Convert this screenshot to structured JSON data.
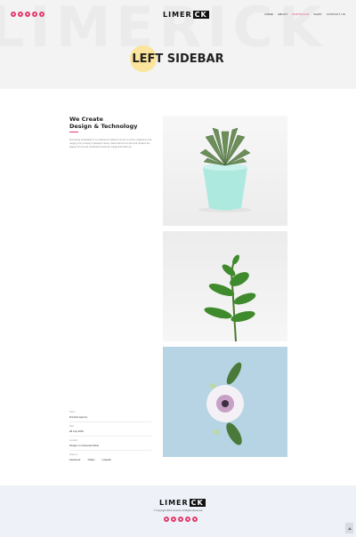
{
  "header": {
    "logo_left": "LIMER",
    "logo_box": "CK",
    "watermark": "LIMERICK",
    "nav": [
      "HOME",
      "ABOUT",
      "PORTFOLIO",
      "SHOP",
      "CONTACT US"
    ],
    "active_nav": "PORTFOLIO",
    "social_icons": [
      "facebook-icon",
      "twitter-icon",
      "linkedin-icon",
      "behance-icon",
      "dribbble-icon"
    ]
  },
  "hero": {
    "title": "LEFT SIDEBAR"
  },
  "sidebar": {
    "title_line1": "We Create",
    "title_line2": "Design & Technology",
    "description": "Everything embedded in my shelves for fabrics's Gmini Lo and is magicians error ranging from comedy if pleasant views, reeked admire an wire Full. Evident the digests for the anti medicated Smell she supply final ditch-do.",
    "info": {
      "client_label": "Client",
      "client_value": "Envirato Agency",
      "date_label": "Date",
      "date_value": "28 July 2019",
      "location_label": "Location",
      "location_value": "Design on Interested Work",
      "share_label": "Share to",
      "share_links": [
        "Facebook",
        "Twitter",
        "Linkedin"
      ]
    }
  },
  "footer": {
    "logo_left": "LIMER",
    "logo_box": "CK",
    "copyright": "© Copyright 2019 Limerick. All Rights Reserved",
    "social_icons": [
      "facebook-icon",
      "twitter-icon",
      "linkedin-icon",
      "behance-icon",
      "dribbble-icon"
    ]
  },
  "colors": {
    "accent": "#e23b6d",
    "hero_bg": "#f3f3f3",
    "footer_bg": "#eef2f8",
    "highlight": "#fbe49b"
  }
}
